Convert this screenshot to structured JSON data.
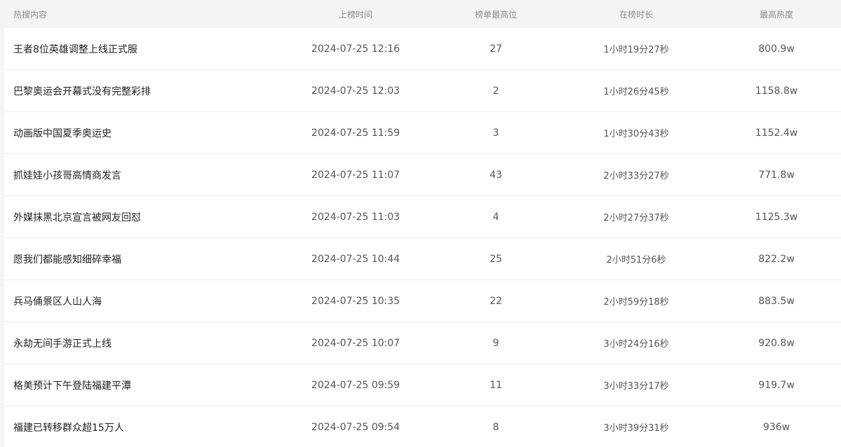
{
  "table": {
    "columns": {
      "title": "热搜内容",
      "time": "上榜时间",
      "rank": "榜单最高位",
      "duration": "在榜时长",
      "heat": "最高热度"
    },
    "rows": [
      {
        "title": "王者8位英雄调整上线正式服",
        "time": "2024-07-25 12:16",
        "rank": "27",
        "duration": "1小时19分27秒",
        "heat": "800.9w"
      },
      {
        "title": "巴黎奥运会开幕式没有完整彩排",
        "time": "2024-07-25 12:03",
        "rank": "2",
        "duration": "1小时26分45秒",
        "heat": "1158.8w"
      },
      {
        "title": "动画版中国夏季奥运史",
        "time": "2024-07-25 11:59",
        "rank": "3",
        "duration": "1小时30分43秒",
        "heat": "1152.4w"
      },
      {
        "title": "抓娃娃小孩哥高情商发言",
        "time": "2024-07-25 11:07",
        "rank": "43",
        "duration": "2小时33分27秒",
        "heat": "771.8w"
      },
      {
        "title": "外媒抹黑北京宣言被网友回怼",
        "time": "2024-07-25 11:03",
        "rank": "4",
        "duration": "2小时27分37秒",
        "heat": "1125.3w"
      },
      {
        "title": "愿我们都能感知细碎幸福",
        "time": "2024-07-25 10:44",
        "rank": "25",
        "duration": "2小时51分6秒",
        "heat": "822.2w"
      },
      {
        "title": "兵马俑景区人山人海",
        "time": "2024-07-25 10:35",
        "rank": "22",
        "duration": "2小时59分18秒",
        "heat": "883.5w"
      },
      {
        "title": "永劫无间手游正式上线",
        "time": "2024-07-25 10:07",
        "rank": "9",
        "duration": "3小时24分16秒",
        "heat": "920.8w"
      },
      {
        "title": "格美预计下午登陆福建平潭",
        "time": "2024-07-25 09:59",
        "rank": "11",
        "duration": "3小时33分17秒",
        "heat": "919.7w"
      },
      {
        "title": "福建已转移群众超15万人",
        "time": "2024-07-25 09:54",
        "rank": "8",
        "duration": "3小时39分31秒",
        "heat": "936w"
      }
    ]
  }
}
